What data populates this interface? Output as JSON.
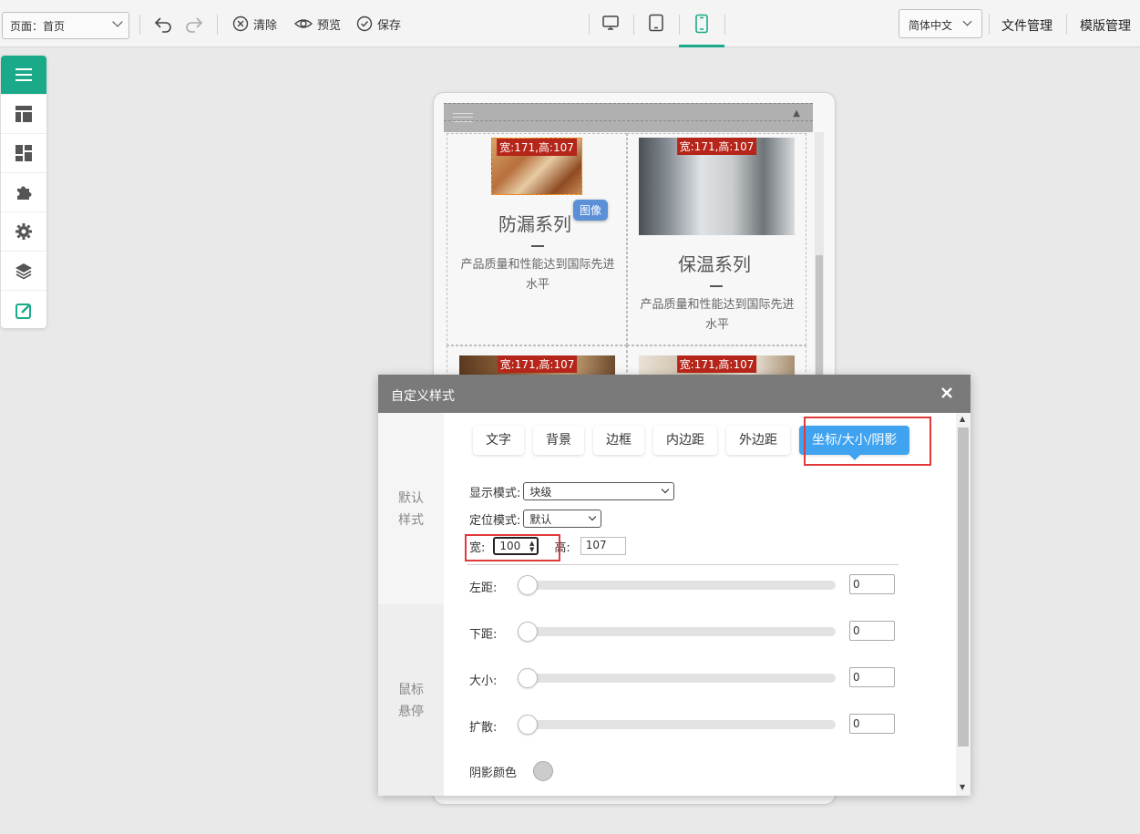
{
  "toolbar": {
    "page_select": "页面：首页",
    "clear_label": "清除",
    "preview_label": "预览",
    "save_label": "保存",
    "language": "简体中文",
    "file_manage": "文件管理",
    "template_manage": "模版管理"
  },
  "left_panel": {
    "items": [
      "menu-icon",
      "layout-icon",
      "dashboard-icon",
      "plugin-icon",
      "settings-icon",
      "layers-icon",
      "edit-icon"
    ],
    "active_index": 0,
    "accent": "#1aaa8a"
  },
  "preview": {
    "cells": [
      {
        "image_label": "宽:171,高:107",
        "title": "防漏系列",
        "desc": "产品质量和性能达到国际先进水平"
      },
      {
        "image_label": "宽:171,高:107",
        "title": "保温系列",
        "desc": "产品质量和性能达到国际先进水平"
      },
      {
        "image_label": "宽:171,高:107"
      },
      {
        "image_label": "宽:171,高:107"
      }
    ],
    "tag": "图像"
  },
  "dialog": {
    "title": "自定义样式",
    "side_default": "默认样式",
    "side_hover": "鼠标悬停",
    "tabs": [
      "文字",
      "背景",
      "边框",
      "内边距",
      "外边距",
      "坐标/大小/阴影"
    ],
    "active_tab": 5,
    "display_mode_label": "显示模式:",
    "display_mode_value": "块级",
    "position_mode_label": "定位模式:",
    "position_mode_value": "默认",
    "width_label": "宽:",
    "width_value": "100",
    "height_label": "高:",
    "height_value": "107",
    "sliders": [
      {
        "label": "左距:",
        "value": "0"
      },
      {
        "label": "下距:",
        "value": "0"
      },
      {
        "label": "大小:",
        "value": "0"
      },
      {
        "label": "扩散:",
        "value": "0"
      }
    ],
    "shadow_color_label": "阴影颜色",
    "shadow_color": "#cccccc",
    "highlight_color": "#e03a3a",
    "tab_active_color": "#3fa3f0"
  }
}
